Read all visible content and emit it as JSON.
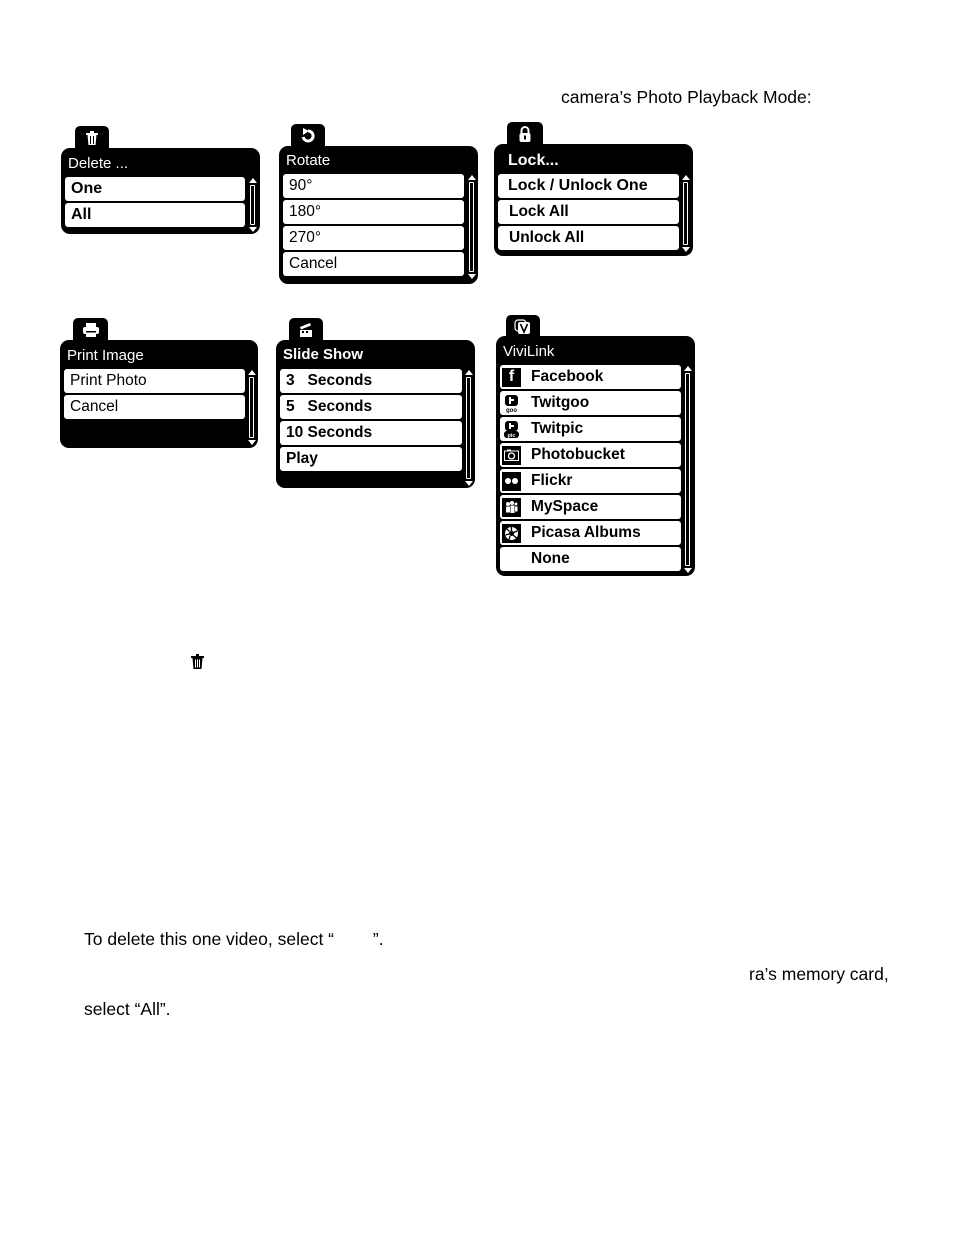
{
  "intro_text": "camera’s Photo Playback Mode:",
  "menus": {
    "delete": {
      "icon": "trash-icon",
      "title": "Delete ...",
      "items": [
        "One",
        "All"
      ]
    },
    "rotate": {
      "icon": "rotate-icon",
      "title": "Rotate",
      "items": [
        "90°",
        "180°",
        "270°",
        "Cancel"
      ]
    },
    "lock": {
      "icon": "lock-icon",
      "title": "Lock...",
      "items": [
        "Lock / Unlock One",
        "Lock All",
        "Unlock All"
      ]
    },
    "print": {
      "icon": "printer-icon",
      "title": "Print Image",
      "items": [
        "Print Photo",
        "Cancel"
      ]
    },
    "slideshow": {
      "icon": "clapperboard-icon",
      "title": "Slide Show",
      "items": [
        "3   Seconds",
        "5   Seconds",
        "10 Seconds",
        "Play"
      ]
    },
    "vivilink": {
      "icon": "vivilink-icon",
      "title": "ViviLink",
      "items": [
        {
          "label": "Facebook",
          "icon": "facebook-icon"
        },
        {
          "label": "Twitgoo",
          "icon": "twitgoo-icon"
        },
        {
          "label": "Twitpic",
          "icon": "twitpic-icon"
        },
        {
          "label": "Photobucket",
          "icon": "photobucket-icon"
        },
        {
          "label": "Flickr",
          "icon": "flickr-icon"
        },
        {
          "label": "MySpace",
          "icon": "myspace-icon"
        },
        {
          "label": "Picasa Albums",
          "icon": "picasa-icon"
        },
        {
          "label": "None",
          "icon": ""
        }
      ]
    }
  },
  "body": {
    "inline_icon": "trash-icon",
    "line1": "To delete this one video, select “        ”.",
    "line2": "ra’s memory card,",
    "line3": "select “All”."
  }
}
